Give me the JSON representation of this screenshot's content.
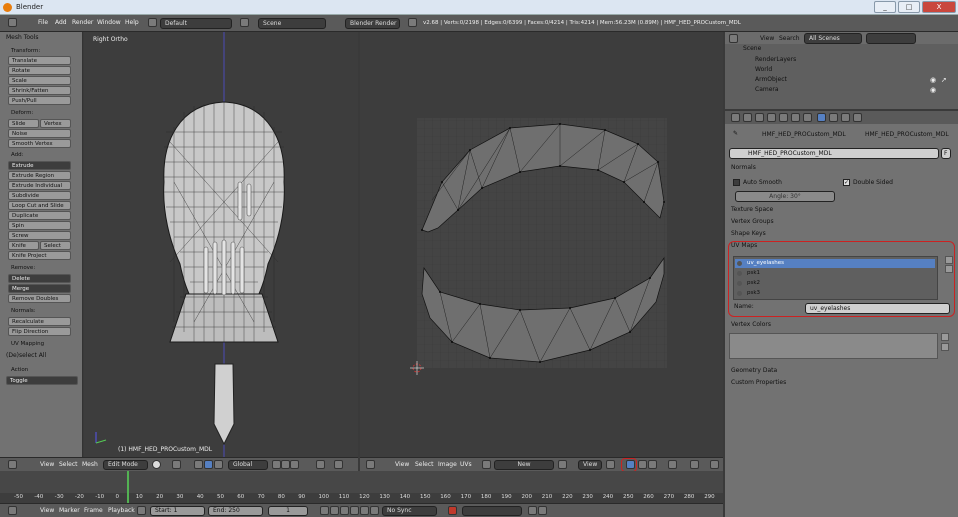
{
  "window": {
    "title": "Blender",
    "controls": [
      "_",
      "□",
      "X"
    ]
  },
  "topbar": {
    "menus": [
      "File",
      "Add",
      "Render",
      "Window",
      "Help"
    ],
    "screen": "Default",
    "scene": "Scene",
    "engine": "Blender Render",
    "stats": "v2.68 | Verts:0/2198 | Edges:0/6399 | Faces:0/4214 | Tris:4214 | Mem:56.23M (0.89M) | HMF_HED_PROCustom_MDL"
  },
  "toolshelf": {
    "title": "Mesh Tools",
    "transform_label": "Transform:",
    "transform": [
      "Translate",
      "Rotate",
      "Scale",
      "Shrink/Fatten",
      "Push/Pull"
    ],
    "deform_label": "Deform:",
    "slide_edge": "Slide Edge",
    "vertex": "Vertex",
    "noise": "Noise",
    "smooth_vertex": "Smooth Vertex",
    "add_label": "Add:",
    "extrude": "Extrude",
    "add_items": [
      "Extrude Region",
      "Extrude Individual",
      "Subdivide",
      "Loop Cut and Slide",
      "Duplicate",
      "Spin",
      "Screw"
    ],
    "knife": "Knife",
    "select": "Select",
    "knife_project": "Knife Project",
    "remove_label": "Remove:",
    "delete": "Delete",
    "merge": "Merge",
    "remove_doubles": "Remove Doubles",
    "normals_label": "Normals:",
    "recalculate": "Recalculate",
    "flip_direction": "Flip Direction",
    "uv_mapping": "UV Mapping",
    "deselect_all": "(De)select All",
    "action_label": "Action",
    "action_value": "Toggle"
  },
  "viewport3d": {
    "view_label": "Right Ortho",
    "object_label": "(1) HMF_HED_PROCustom_MDL",
    "header": {
      "menus": [
        "View",
        "Select",
        "Mesh"
      ],
      "mode": "Edit Mode",
      "orientation": "Global"
    }
  },
  "uv_editor": {
    "header": {
      "menus": [
        "View",
        "Select",
        "Image",
        "UVs"
      ],
      "new_button": "New",
      "view_field": "View"
    }
  },
  "timeline": {
    "ticks": [
      "-50",
      "-40",
      "-30",
      "-20",
      "-10",
      "0",
      "10",
      "20",
      "30",
      "40",
      "50",
      "60",
      "70",
      "80",
      "90",
      "100",
      "110",
      "120",
      "130",
      "140",
      "150",
      "160",
      "170",
      "180",
      "190",
      "200",
      "210",
      "220",
      "230",
      "240",
      "250",
      "260",
      "270",
      "280",
      "290"
    ],
    "menus": [
      "View",
      "Marker",
      "Frame",
      "Playback"
    ],
    "start": "Start: 1",
    "end": "End: 250",
    "current": "1",
    "sync": "No Sync"
  },
  "outliner": {
    "menus": [
      "View",
      "Search"
    ],
    "scope": "All Scenes",
    "tree": [
      "Scene",
      "RenderLayers",
      "World",
      "ArmObject",
      "Camera"
    ]
  },
  "properties": {
    "breadcrumb_obj": "HMF_HED_PROCustom_MDL",
    "breadcrumb_mesh": "HMF_HED_PROCustom_MDL",
    "mesh_name": "HMF_HED_PROCustom_MDL",
    "fake_user": "F",
    "normals_title": "Normals",
    "auto_smooth": "Auto Smooth",
    "double_sided": "Double Sided",
    "angle": "Angle: 30°",
    "sections": [
      "Texture Space",
      "Vertex Groups",
      "Shape Keys"
    ],
    "uv_maps_title": "UV Maps",
    "uv_maps": [
      "uv_eyelashes",
      "psk1",
      "psk2",
      "psk3"
    ],
    "name_label": "Name:",
    "name_value": "uv_eyelashes",
    "vertex_colors_title": "Vertex Colors",
    "geometry_data": "Geometry Data",
    "custom_properties": "Custom Properties"
  },
  "colors": {
    "highlight": "#cc2222",
    "selected": "#5680c2",
    "frame_cursor": "#53b253"
  }
}
